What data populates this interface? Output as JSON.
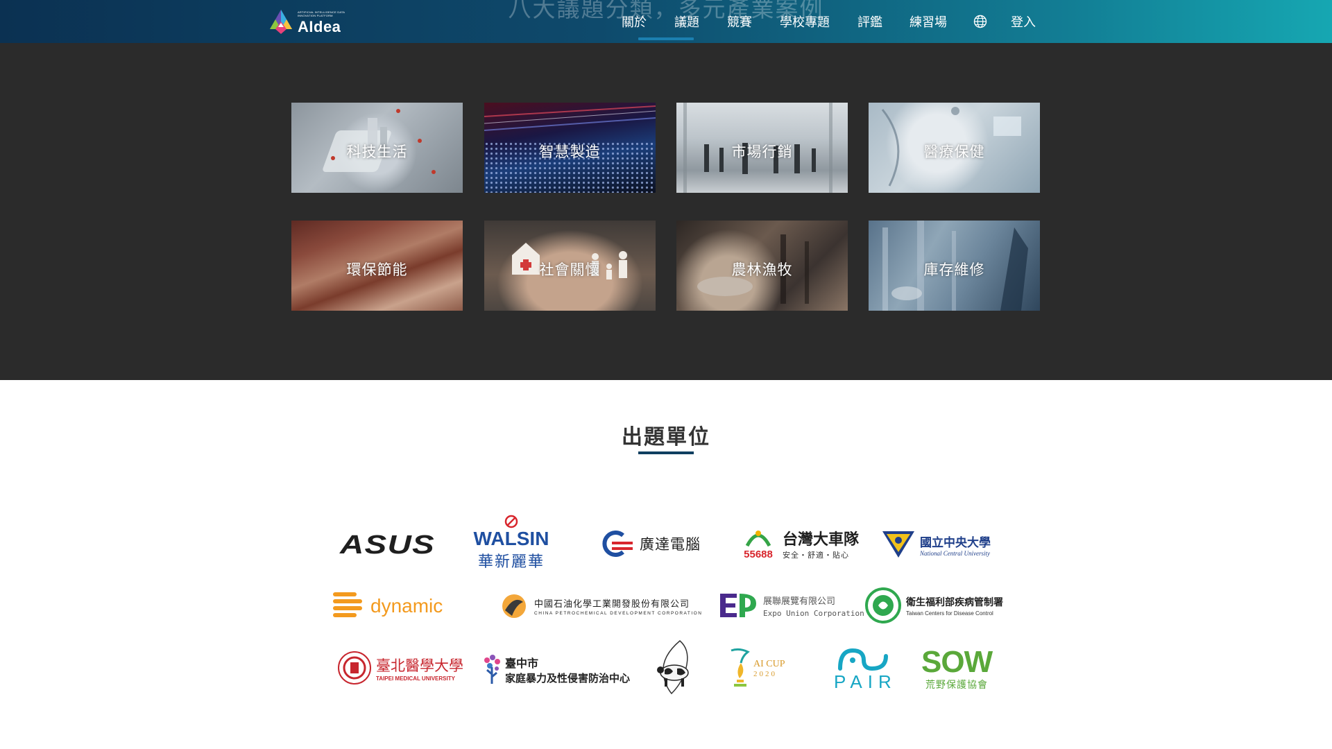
{
  "header": {
    "ghost_title": "八大議題分類，多元產業案例",
    "logo": {
      "small_text": "ARTIFICIAL INTELLIGENCE DATA INNOVATION PLATFORM",
      "text": "AIdea"
    },
    "nav": [
      {
        "id": "about",
        "label": "關於"
      },
      {
        "id": "topics",
        "label": "議題",
        "active": true
      },
      {
        "id": "competitions",
        "label": "競賽"
      },
      {
        "id": "school",
        "label": "學校專題"
      },
      {
        "id": "assessment",
        "label": "評鑑"
      },
      {
        "id": "practice",
        "label": "練習場"
      },
      {
        "id": "login",
        "label": "登入"
      }
    ],
    "language_icon": "globe-icon"
  },
  "topics": [
    {
      "label": "科技生活"
    },
    {
      "label": "智慧製造"
    },
    {
      "label": "市場行銷"
    },
    {
      "label": "醫療保健"
    },
    {
      "label": "環保節能"
    },
    {
      "label": "社會關懷"
    },
    {
      "label": "農林漁牧"
    },
    {
      "label": "庫存維修"
    }
  ],
  "sponsors": {
    "title": "出題單位",
    "logos": {
      "asus": "ASUS",
      "walsin_en": "WALSIN",
      "walsin_zh": "華新麗華",
      "quanta_zh": "廣達電腦",
      "taxi_number": "55688",
      "taxi_zh": "台灣大車隊",
      "taxi_sub": "安全・舒適・貼心",
      "ncu_zh": "國立中央大學",
      "ncu_en": "National Central University",
      "dynamic": "dynamic",
      "cpdc_zh": "中國石油化學工業開發股份有限公司",
      "cpdc_en": "CHINA PETROCHEMICAL DEVELOPMENT CORPORATION",
      "expo_zh": "展聯展覽有限公司",
      "expo_en": "Expo Union Corporation",
      "cdc_zh": "衛生福利部疾病管制署",
      "cdc_en": "Taiwan Centers for Disease Control",
      "tmu_zh": "臺北醫學大學",
      "tmu_en": "TAIPEI MEDICAL UNIVERSITY",
      "tc_line1": "臺中市",
      "tc_line2": "家庭暴力及性侵害防治中心",
      "aicup": "AI CUP",
      "aicup_year": "2020",
      "pair": "PAIR",
      "sow": "SOW",
      "sow_zh": "荒野保護協會"
    }
  },
  "colors": {
    "header_start": "#0b3152",
    "header_end": "#16a7b2",
    "band": "#2b2b2b",
    "accent": "#1b7fb0",
    "title_underline": "#0f3f60"
  }
}
